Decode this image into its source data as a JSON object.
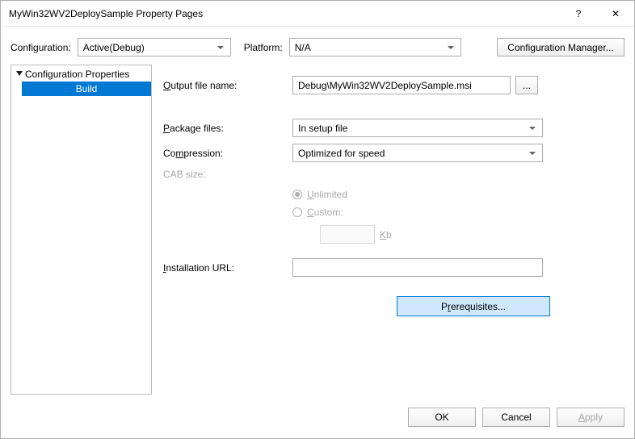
{
  "title": "MyWin32WV2DeploySample Property Pages",
  "titlebar": {
    "help": "?",
    "close": "✕"
  },
  "configRow": {
    "configLabel": "Configuration:",
    "configValue": "Active(Debug)",
    "platformLabel": "Platform:",
    "platformValue": "N/A",
    "configMgr": "Configuration Manager..."
  },
  "tree": {
    "root": "Configuration Properties",
    "child": "Build"
  },
  "form": {
    "outputLabelPre": "O",
    "outputLabelPost": "utput file name:",
    "outputValue": "Debug\\MyWin32WV2DeploySample.msi",
    "browse": "...",
    "packageLabelPre": "P",
    "packageLabelPost": "ackage files:",
    "packageValue": "In setup file",
    "compressionLabelPre": "Co",
    "compressionLabelMid": "m",
    "compressionLabelPost": "pression:",
    "compressionValue": "Optimized for speed",
    "cabLabel": "CAB size:",
    "radioUnlimitedPre": "U",
    "radioUnlimitedPost": "nlimited",
    "radioCustomPre": "C",
    "radioCustomPost": "ustom:",
    "kbLabelPre": "K",
    "kbLabelPost": "b",
    "instUrlLabelPre": "I",
    "instUrlLabelPost": "nstallation URL:",
    "instUrlValue": "",
    "prereqPre": "P",
    "prereqMid": "r",
    "prereqPost": "erequisites..."
  },
  "footer": {
    "ok": "OK",
    "cancel": "Cancel",
    "applyPre": "A",
    "applyPost": "pply"
  }
}
